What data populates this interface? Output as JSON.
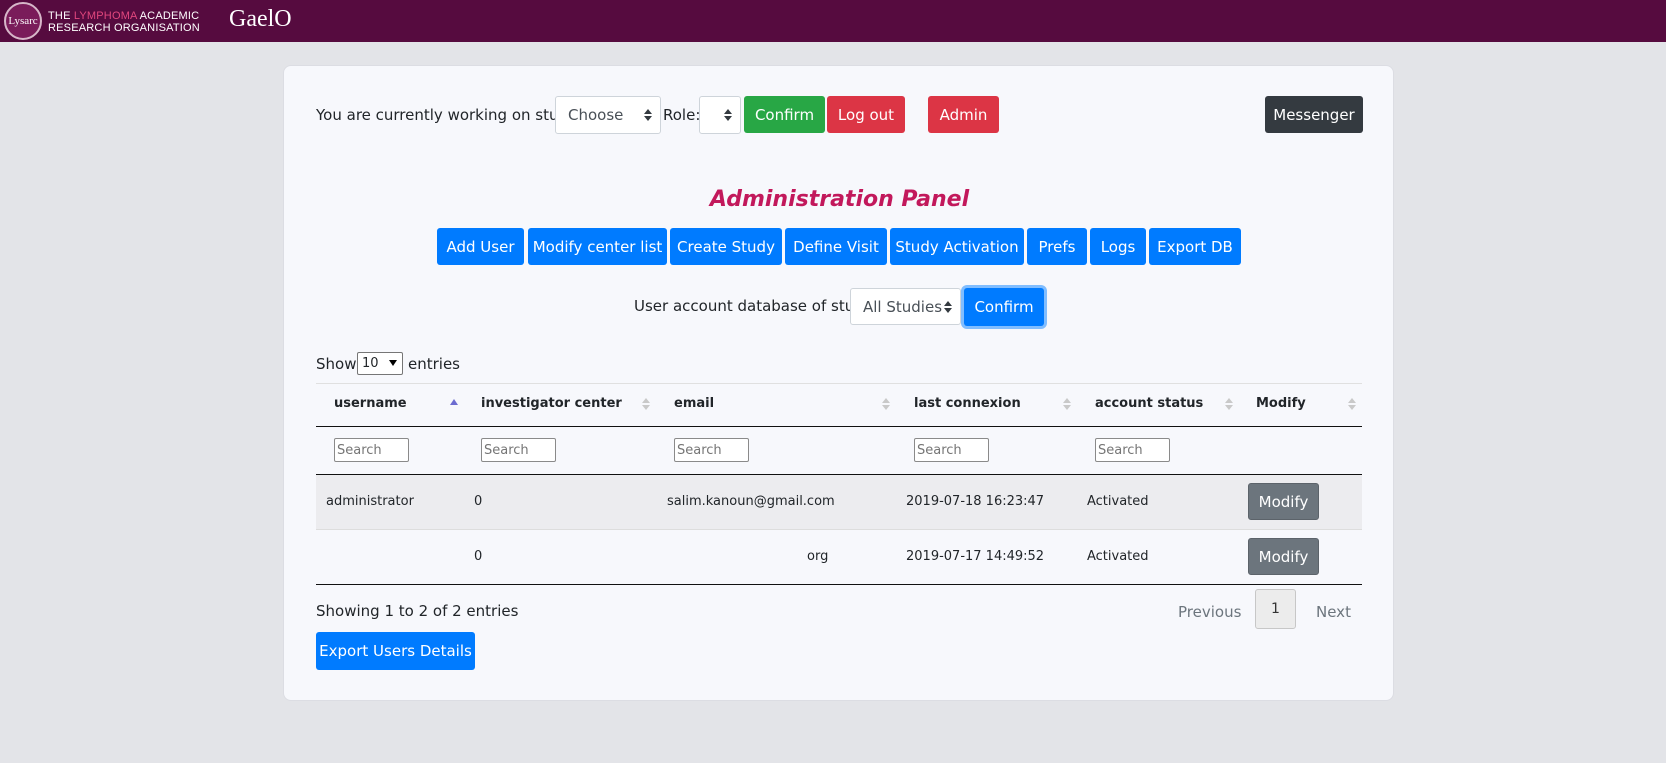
{
  "header": {
    "logo_badge": "Lysarc",
    "logo_line1_pre": "THE ",
    "logo_line1_accent": "LYMPHOMA",
    "logo_line1_post": " ACADEMIC",
    "logo_line2": "RESEARCH ORGANISATION",
    "brand": "GaelO",
    "bar_color": "#560b3f"
  },
  "study_bar": {
    "study_label": "You are currently working on study:",
    "study_select_value": "Choose",
    "role_label": "Role:",
    "role_select_value": "",
    "confirm_label": "Confirm",
    "logout_label": "Log out",
    "admin_label": "Admin",
    "messenger_label": "Messenger"
  },
  "panel": {
    "title": "Administration Panel",
    "title_color": "#c2185b",
    "buttons": [
      "Add User",
      "Modify center list",
      "Create Study",
      "Define Visit",
      "Study Activation",
      "Prefs",
      "Logs",
      "Export DB"
    ]
  },
  "filter": {
    "label": "User account database of study:",
    "select_value": "All Studies",
    "confirm_label": "Confirm"
  },
  "table": {
    "show_label": "Show",
    "page_size": "10",
    "entries_label": "entries",
    "columns": [
      "username",
      "investigator center",
      "email",
      "last connexion",
      "account status",
      "Modify"
    ],
    "search_placeholder": "Search",
    "rows": [
      {
        "username": "administrator",
        "center": "0",
        "email": "salim.kanoun@gmail.com",
        "last": "2019-07-18 16:23:47",
        "status": "Activated",
        "action": "Modify"
      },
      {
        "username": "",
        "center": "0",
        "email": "org",
        "last": "2019-07-17 14:49:52",
        "status": "Activated",
        "action": "Modify"
      }
    ],
    "info": "Showing 1 to 2 of 2 entries",
    "previous": "Previous",
    "page": "1",
    "next": "Next",
    "export_label": "Export Users Details"
  },
  "colors": {
    "primary": "#007bff",
    "success": "#28a745",
    "danger": "#dc3545",
    "dark": "#343a40",
    "secondary": "#6c757d"
  }
}
